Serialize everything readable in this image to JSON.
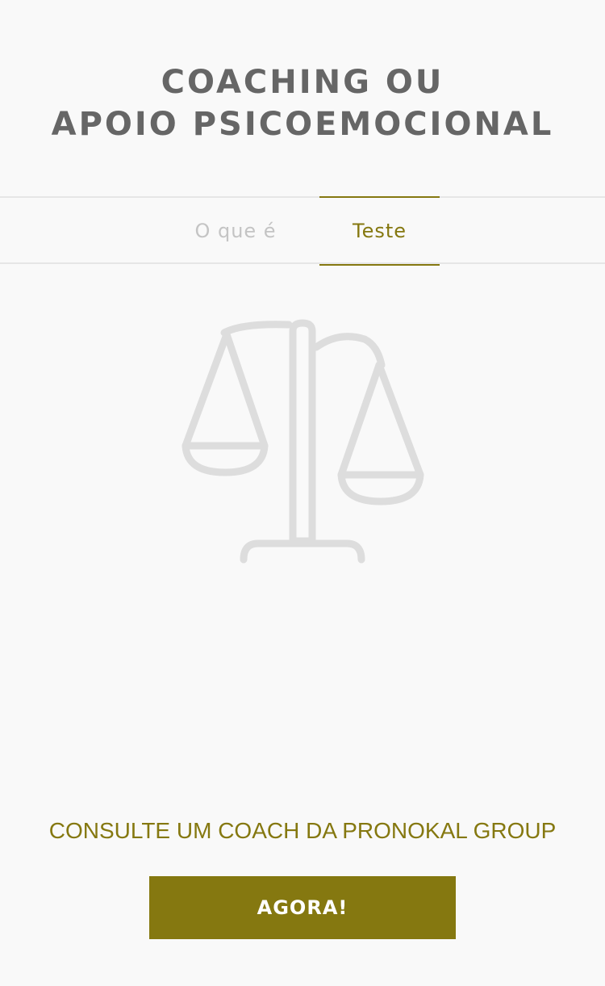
{
  "header": {
    "title_line1": "COACHING OU",
    "title_line2": "APOIO PSICOEMOCIONAL"
  },
  "tabs": [
    {
      "label": "O que é",
      "active": false
    },
    {
      "label": "Teste",
      "active": true
    }
  ],
  "illustration": {
    "icon": "scales-of-justice-icon"
  },
  "cta": {
    "text": "CONSULTE UM COACH DA PRONOKAL GROUP",
    "button_label": "AGORA!"
  },
  "colors": {
    "accent": "#857810",
    "title": "#666666",
    "inactive_tab": "#c4c4c4",
    "icon": "#dddddd",
    "divider": "#e6e6e6",
    "background": "#f9f9f9"
  }
}
